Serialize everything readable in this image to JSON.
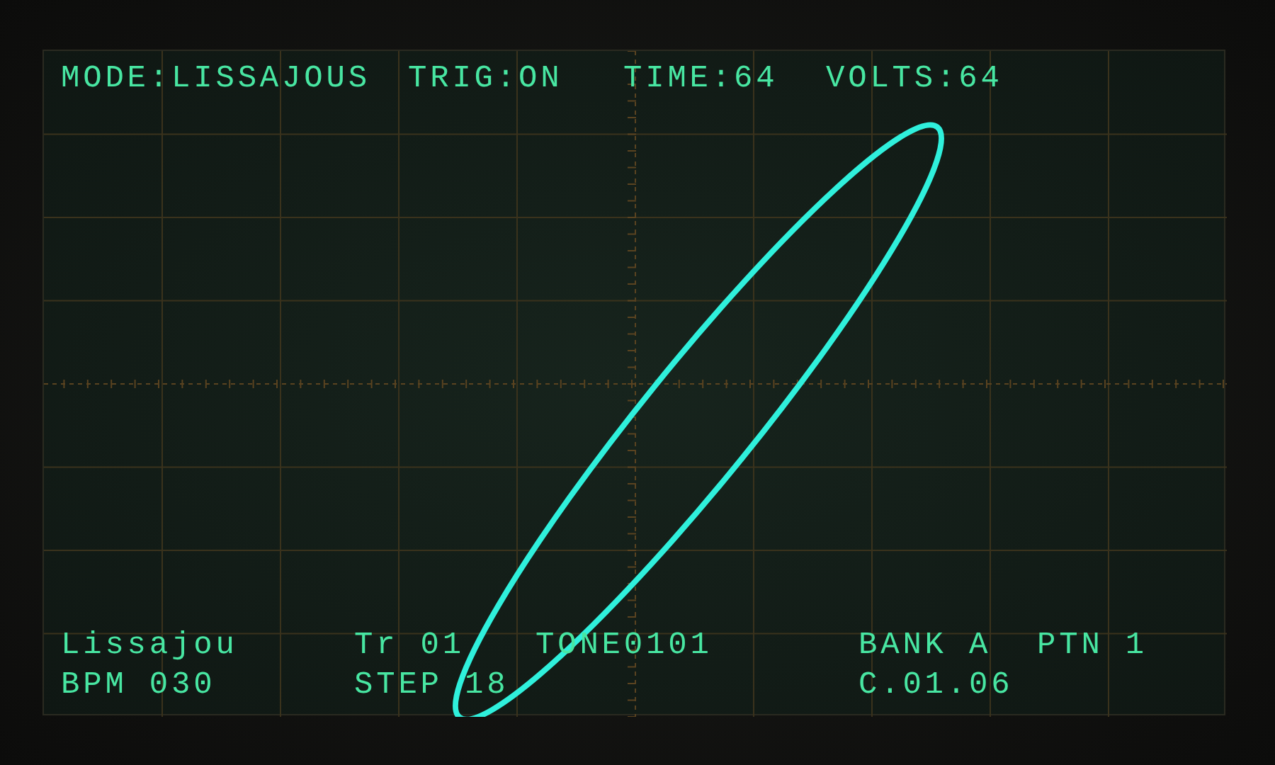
{
  "header": {
    "mode": "MODE:LISSAJOUS",
    "trigger": "TRIG:ON",
    "time": "TIME:64",
    "volts": "VOLTS:64"
  },
  "status": {
    "patch": "Lissajou",
    "track": "Tr 01",
    "tone": "TONE0101",
    "bank": "BANK A",
    "pattern": "PTN 1",
    "bpm": "BPM 030",
    "step": "STEP 18",
    "position": "C.01.06"
  }
}
